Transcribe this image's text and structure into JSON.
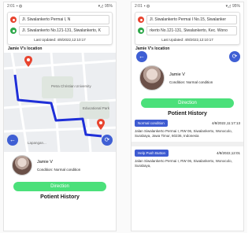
{
  "status": {
    "time": "2:01",
    "right": "95%"
  },
  "screens": [
    {
      "origin_address": "Jl. Siwalankerto Permai I, N",
      "destination_address": "Jl. Siwalankerto No.121-131, Siwalankerto, K",
      "last_updated": "Last Updated: 4/8/2022,12:10:17",
      "location_title": "Jamie V's location",
      "map_labels": [
        "Petra Christian University",
        "Lapangan...",
        "Educational Park"
      ],
      "user_name": "Jamie V",
      "condition_label": "Condition:",
      "condition_value": "Normal condition",
      "direction_label": "Direction",
      "history_title": "Potient History"
    },
    {
      "origin_address": "Jl. Siwalankerto Permai I No.15, Siwalanker",
      "destination_address": "rkerto No.121-131, Siwalankerto, Kec. Wono",
      "last_updated": "Last Updated: 4/8/2022,12:10:17",
      "location_title": "Jamie V's location",
      "user_name": "Jamie V",
      "condition_label": "Condition:",
      "condition_value": "Normal condition",
      "direction_label": "Direction",
      "history_title": "Potient History",
      "history": [
        {
          "tag": "Normal condition",
          "date": "4/8/2022,11:17:13",
          "address": "Jalan Siwalankerto Permai I, RW 06, Siwalankerto, Wonocolo, Surabaya, Jawa Timur, 60236, Indonesia"
        },
        {
          "tag": "Help Push Button",
          "date": "4/8/2022,12:01",
          "address": "Jalan Siwalankerto Permai I, RW 06, Siwalankerto, Wonocolo, Surabaya,"
        }
      ]
    }
  ],
  "icons": {
    "back": "arrow-left-icon",
    "refresh": "refresh-icon",
    "pin": "map-pin-icon"
  },
  "colors": {
    "accent_blue": "#3f5fd4",
    "route_blue": "#1f2fd8",
    "direction_green": "#4be07a",
    "pin_red": "#e8442f",
    "origin_red": "#e8442f",
    "dest_green": "#2ea84a"
  }
}
